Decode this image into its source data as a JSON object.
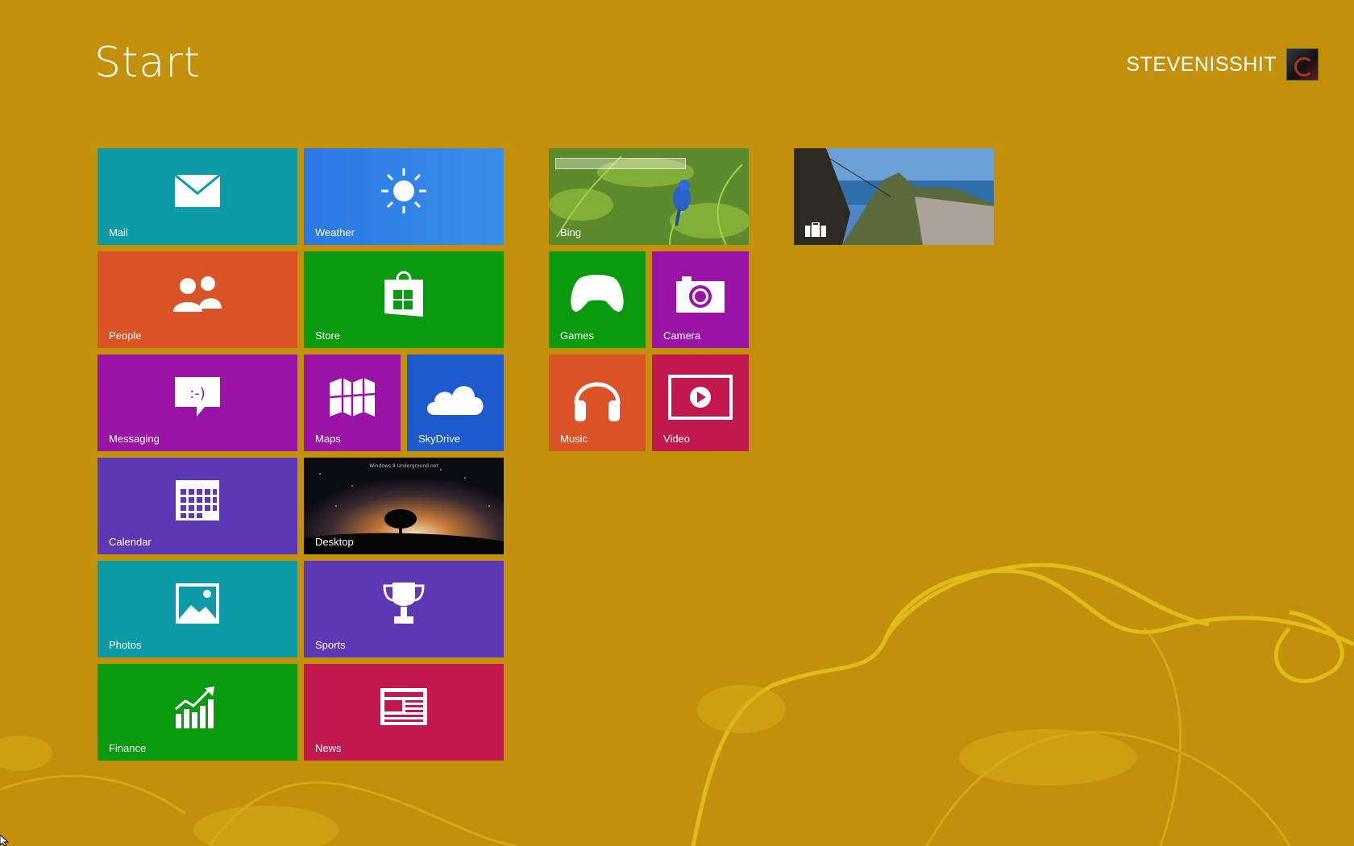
{
  "header": {
    "title": "Start",
    "user_name": "STEVENISSHIT"
  },
  "tiles": {
    "mail": {
      "label": "Mail",
      "icon": "mail-icon",
      "color": "#0e9ba8"
    },
    "weather": {
      "label": "Weather",
      "icon": "sun-icon",
      "color": "#2d7ee6"
    },
    "people": {
      "label": "People",
      "icon": "people-icon",
      "color": "#db5226"
    },
    "store": {
      "label": "Store",
      "icon": "store-bag-icon",
      "color": "#0a9a0e"
    },
    "messaging": {
      "label": "Messaging",
      "icon": "chat-bubble-icon",
      "color": "#9a12a6"
    },
    "maps": {
      "label": "Maps",
      "icon": "map-icon",
      "color": "#9a12a6"
    },
    "skydrive": {
      "label": "SkyDrive",
      "icon": "cloud-icon",
      "color": "#1d5ad0"
    },
    "calendar": {
      "label": "Calendar",
      "icon": "calendar-icon",
      "color": "#5d38b5"
    },
    "desktop": {
      "label": "Desktop",
      "icon": "desktop-wallpaper",
      "wallpaper_text": "Windows 8 Underground.net"
    },
    "photos": {
      "label": "Photos",
      "icon": "photo-icon",
      "color": "#0e9ba8"
    },
    "sports": {
      "label": "Sports",
      "icon": "trophy-icon",
      "color": "#5d38b5"
    },
    "finance": {
      "label": "Finance",
      "icon": "chart-up-icon",
      "color": "#0a9a0e"
    },
    "news": {
      "label": "News",
      "icon": "newspaper-icon",
      "color": "#c2184e"
    },
    "bing": {
      "label": "Bing",
      "icon": "bird-photo"
    },
    "games": {
      "label": "Games",
      "icon": "gamepad-icon",
      "color": "#0a9a0e"
    },
    "camera": {
      "label": "Camera",
      "icon": "camera-icon",
      "color": "#9a12a6"
    },
    "music": {
      "label": "Music",
      "icon": "headphones-icon",
      "color": "#db5226"
    },
    "video": {
      "label": "Video",
      "icon": "play-screen-icon",
      "color": "#c2184e"
    },
    "travel": {
      "label": "",
      "icon": "suitcase-icon"
    }
  },
  "colors": {
    "background": "#c3900c",
    "swirl": "#e6c21a"
  }
}
